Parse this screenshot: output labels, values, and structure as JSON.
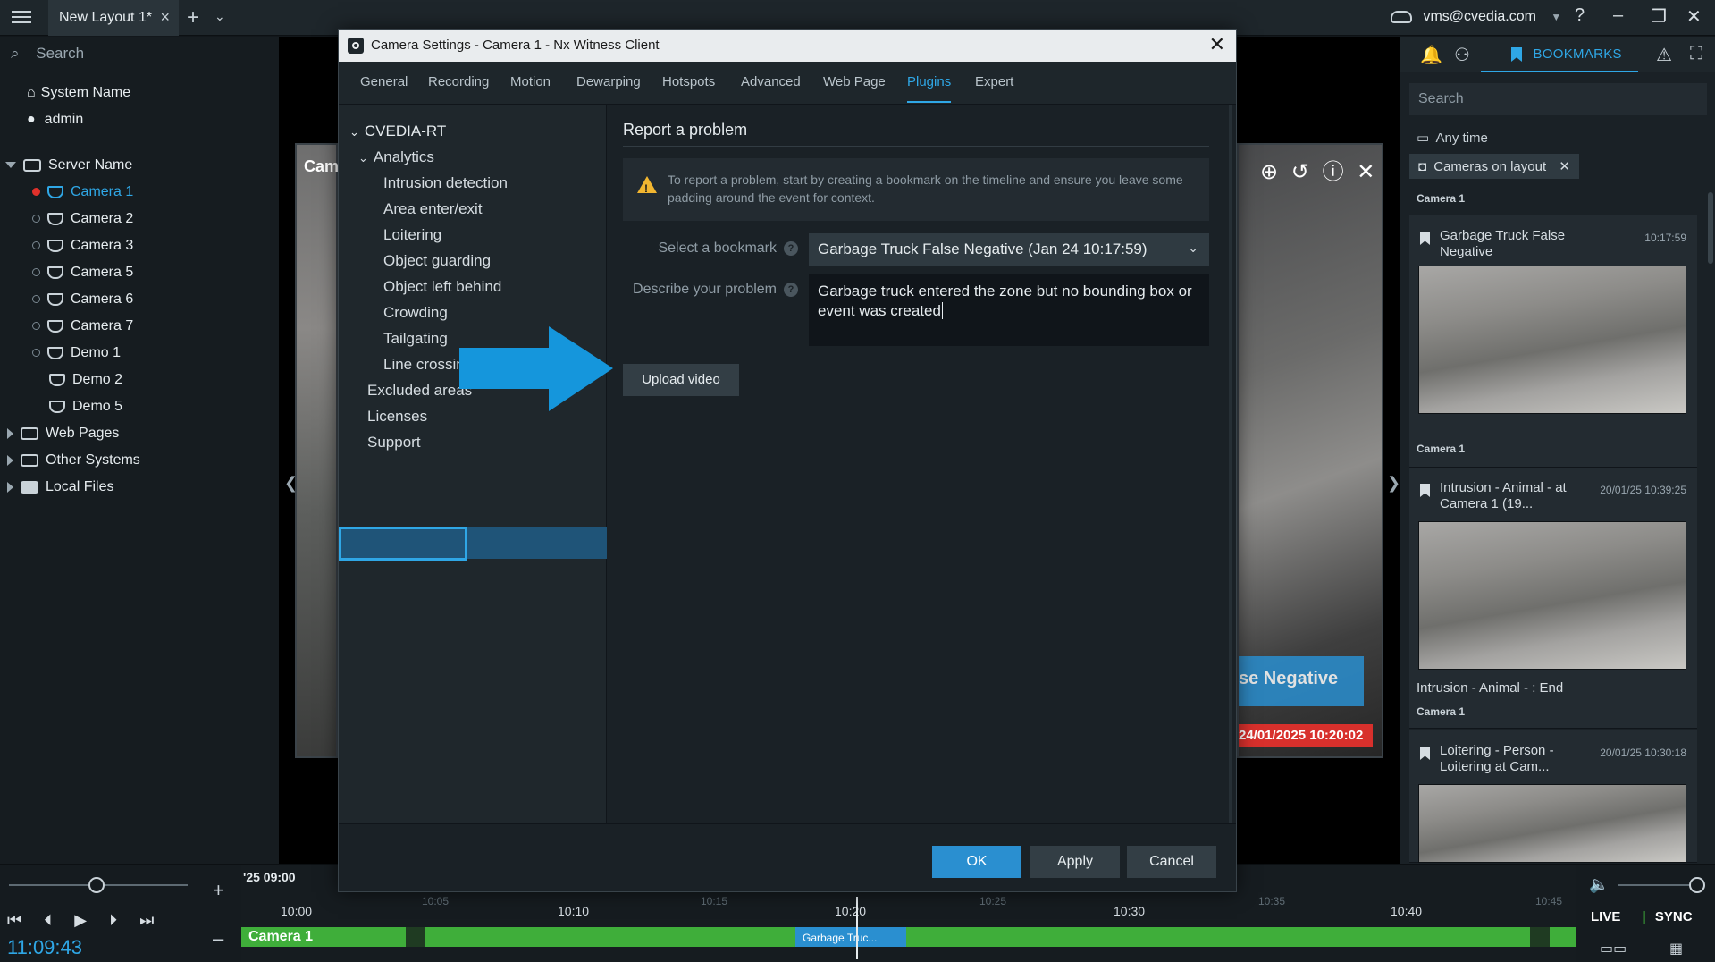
{
  "topbar": {
    "layout_tab": "New Layout 1*",
    "user": "vms@cvedia.com",
    "help": "?",
    "plus": "+"
  },
  "left_tree": {
    "search_placeholder": "Search",
    "system_name": "System Name",
    "admin": "admin",
    "server_name": "Server Name",
    "cameras": [
      "Camera 1",
      "Camera 2",
      "Camera 3",
      "Camera 5",
      "Camera 6",
      "Camera 7",
      "Demo 1",
      "Demo 2",
      "Demo 5"
    ],
    "web_pages": "Web Pages",
    "other_systems": "Other Systems",
    "local_files": "Local Files"
  },
  "scene": {
    "left_cam_label": "Cam",
    "right_cam_overlay": "se Negative",
    "right_cam_timestamp": "24/01/2025 10:20:02"
  },
  "dialog": {
    "title": "Camera Settings - Camera 1 - Nx Witness Client",
    "tabs": [
      "General",
      "Recording",
      "Motion",
      "Dewarping",
      "Hotspots",
      "Advanced",
      "Web Page",
      "Plugins",
      "Expert"
    ],
    "active_tab": "Plugins",
    "nav": {
      "root": "CVEDIA-RT",
      "analytics": "Analytics",
      "items": [
        "Intrusion detection",
        "Area enter/exit",
        "Loitering",
        "Object guarding",
        "Object left behind",
        "Crowding",
        "Tailgating",
        "Line crossing"
      ],
      "excluded": "Excluded areas",
      "licenses": "Licenses",
      "support": "Support"
    },
    "content": {
      "title": "Report a problem",
      "alert": "To report a problem, start by creating a bookmark on the timeline and ensure you leave some padding around the event for context.",
      "select_label": "Select a bookmark",
      "select_value": "Garbage Truck False Negative (Jan 24 10:17:59)",
      "describe_label": "Describe your problem",
      "describe_value": "Garbage truck entered the zone but no bounding box or event was created",
      "upload_button": "Upload video",
      "help_glyph": "?"
    },
    "footer": {
      "ok": "OK",
      "apply": "Apply",
      "cancel": "Cancel"
    }
  },
  "right_panel": {
    "tab_label": "BOOKMARKS",
    "search_placeholder": "Search",
    "time_filter": "Any time",
    "chip": "Cameras on layout",
    "bookmarks": [
      {
        "camera": "Camera 1",
        "title": "Garbage Truck False Negative",
        "time": "10:17:59",
        "end": ""
      },
      {
        "camera": "Camera 1",
        "title": "Intrusion - Animal - at Camera 1 (19...",
        "time": "20/01/25 10:39:25",
        "end": "Intrusion - Animal - : End"
      },
      {
        "camera": "Camera 1",
        "title": "Loitering - Person - Loitering at Cam...",
        "time": "20/01/25 10:30:18",
        "end": ""
      }
    ]
  },
  "timeline": {
    "clock": "11:09:43",
    "date_label": "'25 09:00",
    "major_ticks": [
      "10:00",
      "10:10",
      "10:20",
      "10:30",
      "10:40"
    ],
    "minor_ticks": [
      "10:05",
      "10:15",
      "10:25",
      "10:35",
      "10:45"
    ],
    "camera_label": "Camera 1",
    "bookmark_label": "Garbage Truc...",
    "live": "LIVE",
    "sync": "SYNC",
    "zoom_in": "+",
    "zoom_out": "–"
  },
  "colors": {
    "accent": "#2fa7e6",
    "ok_button": "#2a8fd0",
    "timeline_green": "#3fae3a",
    "recording_red": "#e0312b",
    "warning": "#f2b630"
  }
}
